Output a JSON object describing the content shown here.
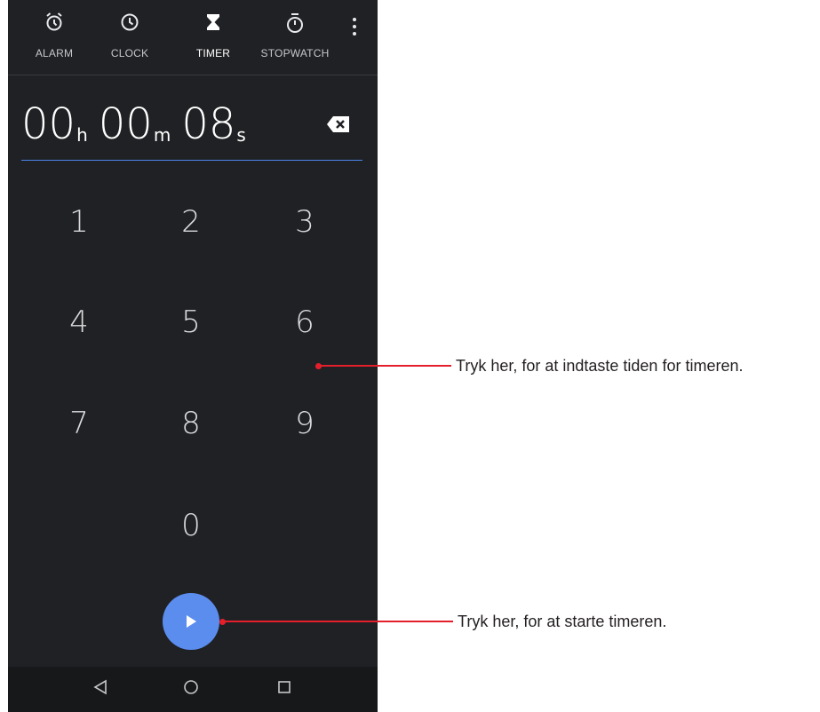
{
  "tabs": [
    {
      "label": "ALARM",
      "icon": "alarm-icon"
    },
    {
      "label": "CLOCK",
      "icon": "clock-icon"
    },
    {
      "label": "TIMER",
      "icon": "hourglass-icon",
      "active": true
    },
    {
      "label": "STOPWATCH",
      "icon": "stopwatch-icon"
    }
  ],
  "timer": {
    "hours": "00",
    "hours_unit": "h",
    "minutes": "00",
    "minutes_unit": "m",
    "seconds": "08",
    "seconds_unit": "s"
  },
  "keypad": [
    "1",
    "2",
    "3",
    "4",
    "5",
    "6",
    "7",
    "8",
    "9",
    "0"
  ],
  "callouts": {
    "keypad": "Tryk her, for at indtaste tiden for timeren.",
    "start": "Tryk her, for at starte timeren."
  },
  "colors": {
    "background": "#202124",
    "accent": "#5b8def",
    "underline": "#4a86e8",
    "callout": "#e41f2b"
  }
}
